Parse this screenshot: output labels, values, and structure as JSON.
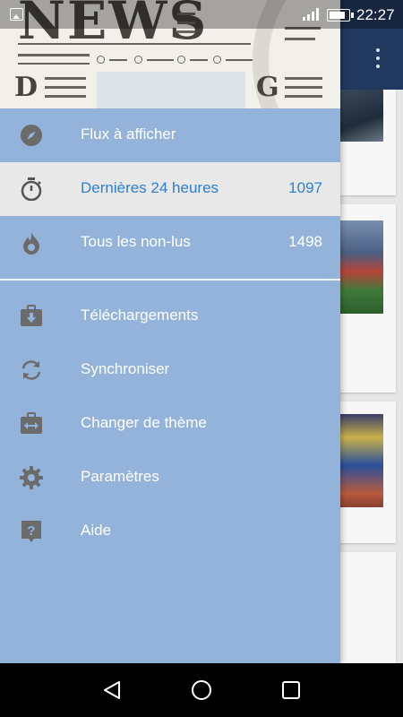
{
  "status_bar": {
    "time": "22:27"
  },
  "header_image": {
    "masthead": "NEWS",
    "letter_left": "D",
    "letter_right": "G"
  },
  "drawer": {
    "top_items": [
      {
        "label": "Flux à afficher",
        "count": "",
        "icon": "compass-icon"
      },
      {
        "label": "Dernières 24 heures",
        "count": "1097",
        "icon": "stopwatch-icon",
        "selected": true
      },
      {
        "label": "Tous les non-lus",
        "count": "1498",
        "icon": "flame-icon"
      }
    ],
    "bottom_items": [
      {
        "label": "Téléchargements",
        "icon": "download-box-icon"
      },
      {
        "label": "Synchroniser",
        "icon": "sync-icon"
      },
      {
        "label": "Changer de thème",
        "icon": "swap-theme-icon"
      },
      {
        "label": "Paramètres",
        "icon": "gear-icon"
      },
      {
        "label": "Aide",
        "icon": "help-icon"
      }
    ]
  },
  "colors": {
    "drawer_bg": "#94b3db",
    "selected_bg": "#e8e8e8",
    "selected_text": "#2f7fd0",
    "icon_gray": "#6b6b6b",
    "toolbar_bg": "#22395f"
  }
}
